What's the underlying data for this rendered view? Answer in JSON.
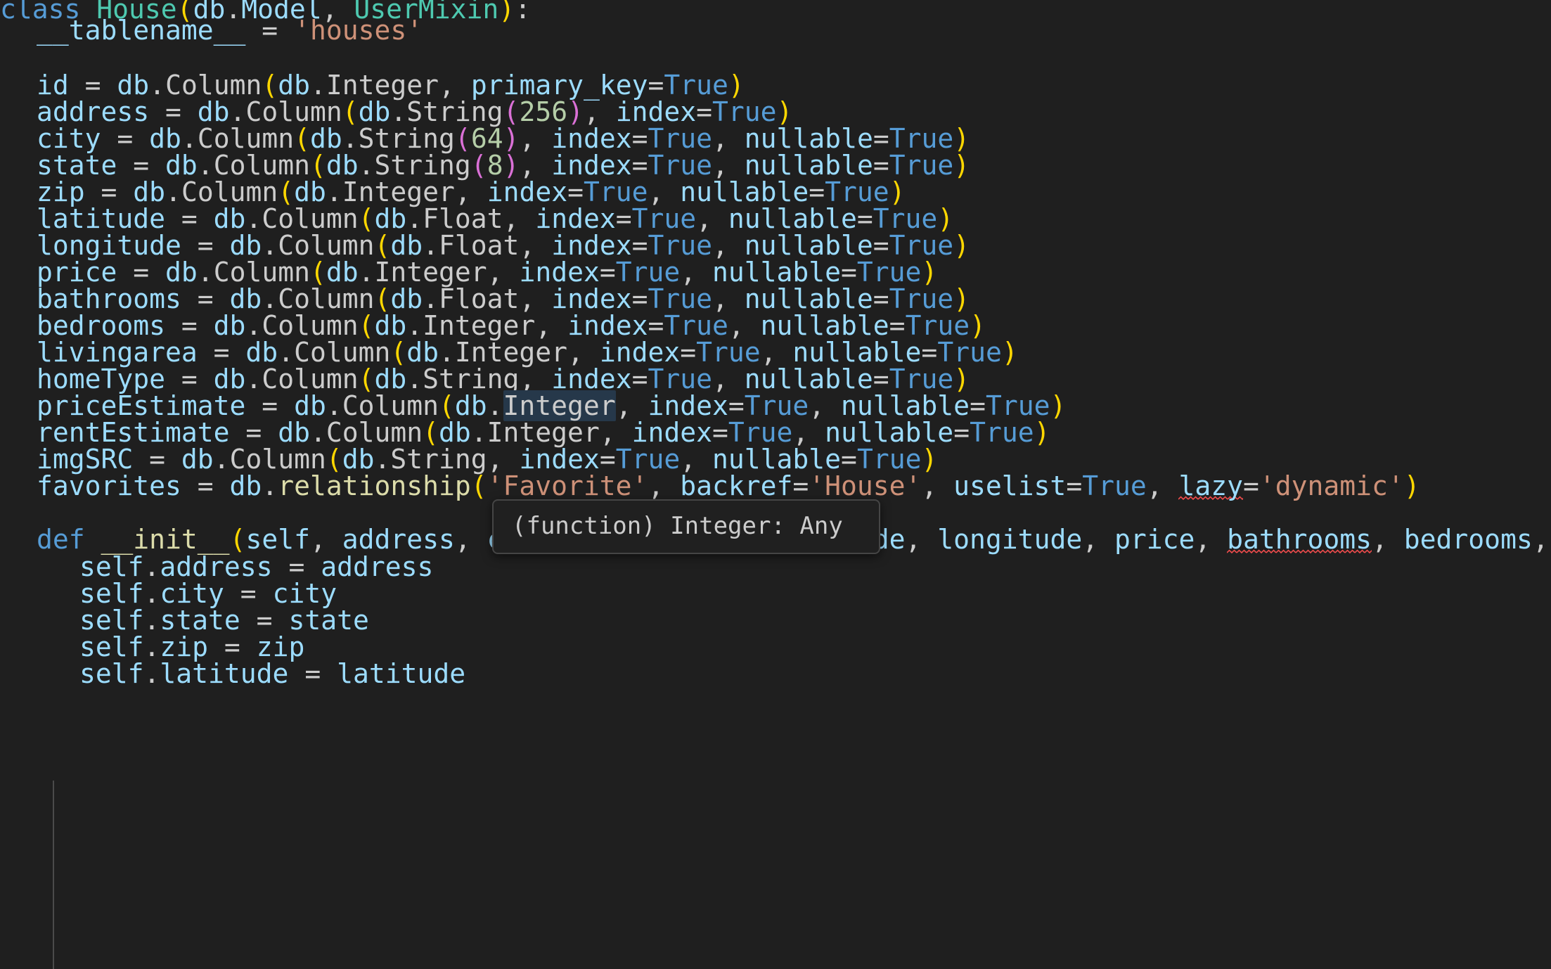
{
  "editor": {
    "language": "python",
    "theme": "Dark Modern",
    "background_color": "#1f1f1f",
    "default_text_color": "#cccccc",
    "colors": {
      "keyword": "#569cd6",
      "class_name": "#4ec9b0",
      "identifier": "#9cdcfe",
      "string": "#ce9178",
      "number": "#b5cea8",
      "function": "#dcdcaa",
      "bracket_level1": "#ffd700",
      "bracket_level2": "#da70d6",
      "error_squiggle": "#f14c4c",
      "hover_highlight": "#26384a",
      "indent_guide": "#4a4a4a"
    },
    "lines": [
      "class House(db.Model, UserMixin):",
      "    __tablename__ = 'houses'",
      "",
      "    id = db.Column(db.Integer, primary_key=True)",
      "    address = db.Column(db.String(256), index=True)",
      "    city = db.Column(db.String(64), index=True, nullable=True)",
      "    state = db.Column(db.String(8), index=True, nullable=True)",
      "    zip = db.Column(db.Integer, index=True, nullable=True)",
      "    latitude = db.Column(db.Float, index=True, nullable=True)",
      "    longitude = db.Column(db.Float, index=True, nullable=True)",
      "    price = db.Column(db.Integer, index=True, nullable=True)",
      "    bathrooms = db.Column(db.Float, index=True, nullable=True)",
      "    bedrooms = db.Column(db.Integer, index=True, nullable=True)",
      "    livingarea = db.Column(db.Integer, index=True, nullable=True)",
      "    homeType = db.Column(db.String, index=True, nullable=True)",
      "    priceEstimate = db.Column(db.Integer, index=True, nullable=True)",
      "    rentEstimate = db.Column(db.Integer, index=True, nullable=True)",
      "    imgSRC = db.Column(db.String, index=True, nullable=True)",
      "    favorites = db.relationship('Favorite', backref='House', uselist=True, lazy='dynamic')",
      "",
      "    def __init__(self, address, city, state, zip, latitude, longitude, price, bathrooms, bedrooms, livi",
      "        self.address = address",
      "        self.city = city",
      "        self.state = state",
      "        self.zip = zip",
      "        self.latitude = latitude"
    ]
  },
  "tokens": {
    "kw_class": "class",
    "kw_def": "def",
    "name_house": "House",
    "name_usermixin": "UserMixin",
    "name_db": "db",
    "name_model": "Model",
    "attr_tablename": "__tablename__",
    "str_houses": "'houses'",
    "str_favorite": "'Favorite'",
    "str_house": "'House'",
    "str_dynamic": "'dynamic'",
    "fn_column": "Column",
    "fn_relationship": "relationship",
    "fn_init": "__init__",
    "type_integer": "Integer",
    "type_string": "String",
    "type_float": "Float",
    "bool_true": "True",
    "kwarg_primary_key": "primary_key",
    "kwarg_index": "index",
    "kwarg_nullable": "nullable",
    "kwarg_backref": "backref",
    "kwarg_uselist": "uselist",
    "kwarg_lazy": "lazy",
    "num_256": "256",
    "num_64": "64",
    "num_8": "8"
  },
  "hover_tooltip": {
    "visible": true,
    "text": "(function) Integer: Any",
    "kind": "function",
    "symbol": "Integer",
    "type": "Any"
  },
  "hovered_word": {
    "text": "Integer",
    "line_index": 15,
    "line_text": "priceEstimate = db.Column(db.Integer, index=True, nullable=True)"
  },
  "diagnostics": [
    {
      "word": "lazy",
      "line_index": 18,
      "severity": "warning"
    },
    {
      "word": "bathrooms",
      "line_index": 20,
      "severity": "warning"
    }
  ]
}
